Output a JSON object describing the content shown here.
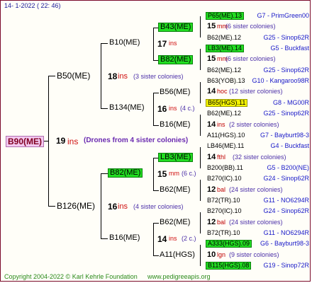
{
  "header": {
    "date": "14-  1-2022 (  22: 46)"
  },
  "root": {
    "label": "B90(ME)",
    "ins_num": "19",
    "ins": "ins",
    "note": "(Drones from 4 sister colonies)"
  },
  "gen1": {
    "top": {
      "label": "B50(ME)",
      "ins_num": "18",
      "ins": "ins",
      "note": "(3 sister colonies)"
    },
    "bottom": {
      "label": "B126(ME)",
      "ins_num": "16",
      "ins": "ins",
      "note": "(4 sister colonies)"
    }
  },
  "gen2": {
    "b10": {
      "label": "B10(ME)",
      "ins_num": "17",
      "ins": "ins"
    },
    "b134": {
      "label": "B134(ME)",
      "ins_num": "16",
      "ins": "ins",
      "note": "(4 c.)"
    },
    "b82": {
      "label": "B82(ME)",
      "ins_num": "15",
      "ins": "mm",
      "note": "(6 c.)"
    },
    "b16": {
      "label": "B16(ME)",
      "ins_num": "14",
      "ins": "ins",
      "note": "(2 c.)"
    }
  },
  "gen3": {
    "b43": "B43(ME)",
    "b82a": "B82(ME)",
    "b56": "B56(ME)",
    "b16": "B16(ME)",
    "lb3": "LB3(ME)",
    "b62": "B62(ME)",
    "b62b": "B62(ME)",
    "a11": "A11(HGS)"
  },
  "gen4": [
    {
      "left": "P65(ME).13",
      "right": "G7 - PrimGreen00",
      "style": "green"
    },
    {
      "num": "15",
      "ins": "mm",
      "note": "(6 sister colonies)"
    },
    {
      "left": "B62(ME).12",
      "right": "G25 - Sinop62R"
    },
    {
      "left": "LB3(ME).14",
      "right": "G5 - Buckfast",
      "style": "green"
    },
    {
      "num": "15",
      "ins": "mm",
      "note": "(6 sister colonies)"
    },
    {
      "left": "B62(ME).12",
      "right": "G25 - Sinop62R"
    },
    {
      "left": "B63(YOB).13",
      "right": "G10 - Kangaroo98R"
    },
    {
      "num": "14",
      "ins": "hoc",
      "note": "(12 sister colonies)"
    },
    {
      "left": "B65(HGS).11",
      "right": "G8 - MG00R",
      "style": "yellow"
    },
    {
      "left": "B62(ME).12",
      "right": "G25 - Sinop62R"
    },
    {
      "num": "14",
      "ins": "ins",
      "note": "(2 sister colonies)"
    },
    {
      "left": "A11(HGS).10",
      "right": "G7 - Bayburt98-3"
    },
    {
      "left": "LB46(ME).11",
      "right": "G4 - Buckfast"
    },
    {
      "num": "14",
      "ins": "fthl",
      "note": "(32 sister colonies)"
    },
    {
      "left": "B200(BB).11",
      "right": "G5 - B200(NE)"
    },
    {
      "left": "B270(IC).10",
      "right": "G24 - Sinop62R"
    },
    {
      "num": "12",
      "ins": "bal",
      "note": "(24 sister colonies)"
    },
    {
      "left": "B72(TR).10",
      "right": "G11 - NO6294R"
    },
    {
      "left": "B270(IC).10",
      "right": "G24 - Sinop62R"
    },
    {
      "num": "12",
      "ins": "bal",
      "note": "(24 sister colonies)"
    },
    {
      "left": "B72(TR).10",
      "right": "G11 - NO6294R"
    },
    {
      "left": "A333(HGS).09",
      "right": "G6 - Bayburt98-3",
      "style": "green"
    },
    {
      "num": "10",
      "ins": "lgn",
      "note": "(9 sister colonies)"
    },
    {
      "left": "B115(HGS).08",
      "right": "G19 - Sinop72R",
      "style": "green"
    }
  ],
  "footer": {
    "copyright": "Copyright 2004-2022 © Karl Kehrle Foundation",
    "site": "www.pedigreeapis.org"
  },
  "colors": {
    "green": "#22dd22",
    "yellow": "#f5f500",
    "ins_red": "#d01010",
    "note_purple": "#4b2fa8",
    "main_maroon": "#800020"
  }
}
